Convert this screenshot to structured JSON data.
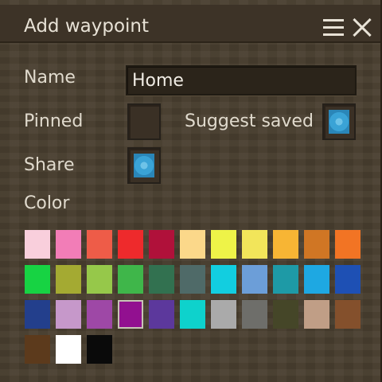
{
  "dialog": {
    "title": "Add waypoint",
    "menu_icon": "hamburger-menu-icon",
    "close_icon": "close-icon"
  },
  "form": {
    "name_label": "Name",
    "name_value": "Home",
    "pinned_label": "Pinned",
    "pinned_checked": false,
    "suggest_saved_label": "Suggest saved",
    "suggest_saved_checked": true,
    "share_label": "Share",
    "share_checked": true,
    "color_label": "Color"
  },
  "colors": {
    "toggle_on": "#2f9acf",
    "selected_index": 25,
    "palette": [
      "#f9cfdc",
      "#f27db7",
      "#ee5c48",
      "#ee2a2c",
      "#b0113a",
      "#fbd88a",
      "#eef348",
      "#f2e55a",
      "#f7b534",
      "#d07624",
      "#f27424",
      "#17d343",
      "#a4aa32",
      "#96c84a",
      "#3fb64a",
      "#327150",
      "#4f6a68",
      "#12cee0",
      "#6c9ed8",
      "#1e9aa6",
      "#1ea8e2",
      "#1e50b4",
      "#233f8c",
      "#c698ca",
      "#9e48a6",
      "#921090",
      "#5c389c",
      "#0ed2cc",
      "#aaaaaa",
      "#6e6e6a",
      "#454628",
      "#c09e86",
      "#84502c",
      "#5c3a1c",
      "#ffffff",
      "#0a0a0a"
    ]
  }
}
